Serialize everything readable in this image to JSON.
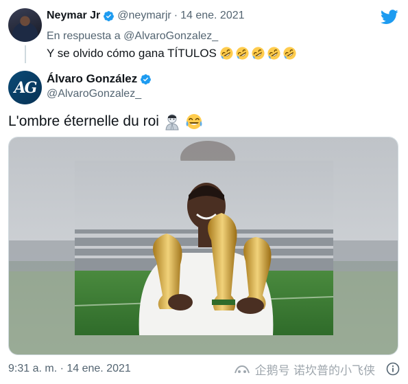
{
  "reply_tweet": {
    "author_name": "Neymar Jr",
    "author_handle": "@neymarjr",
    "separator": "·",
    "date": "14 ene. 2021",
    "reply_to_prefix": "En respuesta a",
    "reply_to_handle": "@AlvaroGonzalez_",
    "text": "Y se olvido cómo gana TÍTULOS",
    "emoji": [
      "rolling-on-floor-laughing",
      "rolling-on-floor-laughing",
      "rolling-on-floor-laughing",
      "rolling-on-floor-laughing",
      "rolling-on-floor-laughing"
    ]
  },
  "main_tweet": {
    "author_name": "Álvaro González",
    "author_handle": "@AlvaroGonzalez_",
    "avatar_initials": "AG",
    "text": "L'ombre éternelle du roi",
    "emoji": [
      "ghost-person",
      "face-with-tears-of-joy"
    ],
    "timestamp": "9:31 a. m. · 14 ene. 2021"
  },
  "watermark": {
    "text": "企鹅号 诺坎普的小飞侠"
  },
  "colors": {
    "twitter_blue": "#1d9bf0",
    "text_primary": "#0f1419",
    "text_secondary": "#536471",
    "border": "#cfd9de"
  },
  "icons": {
    "brand": "twitter-bird-icon",
    "verified": "verified-badge-icon",
    "info": "info-icon"
  }
}
